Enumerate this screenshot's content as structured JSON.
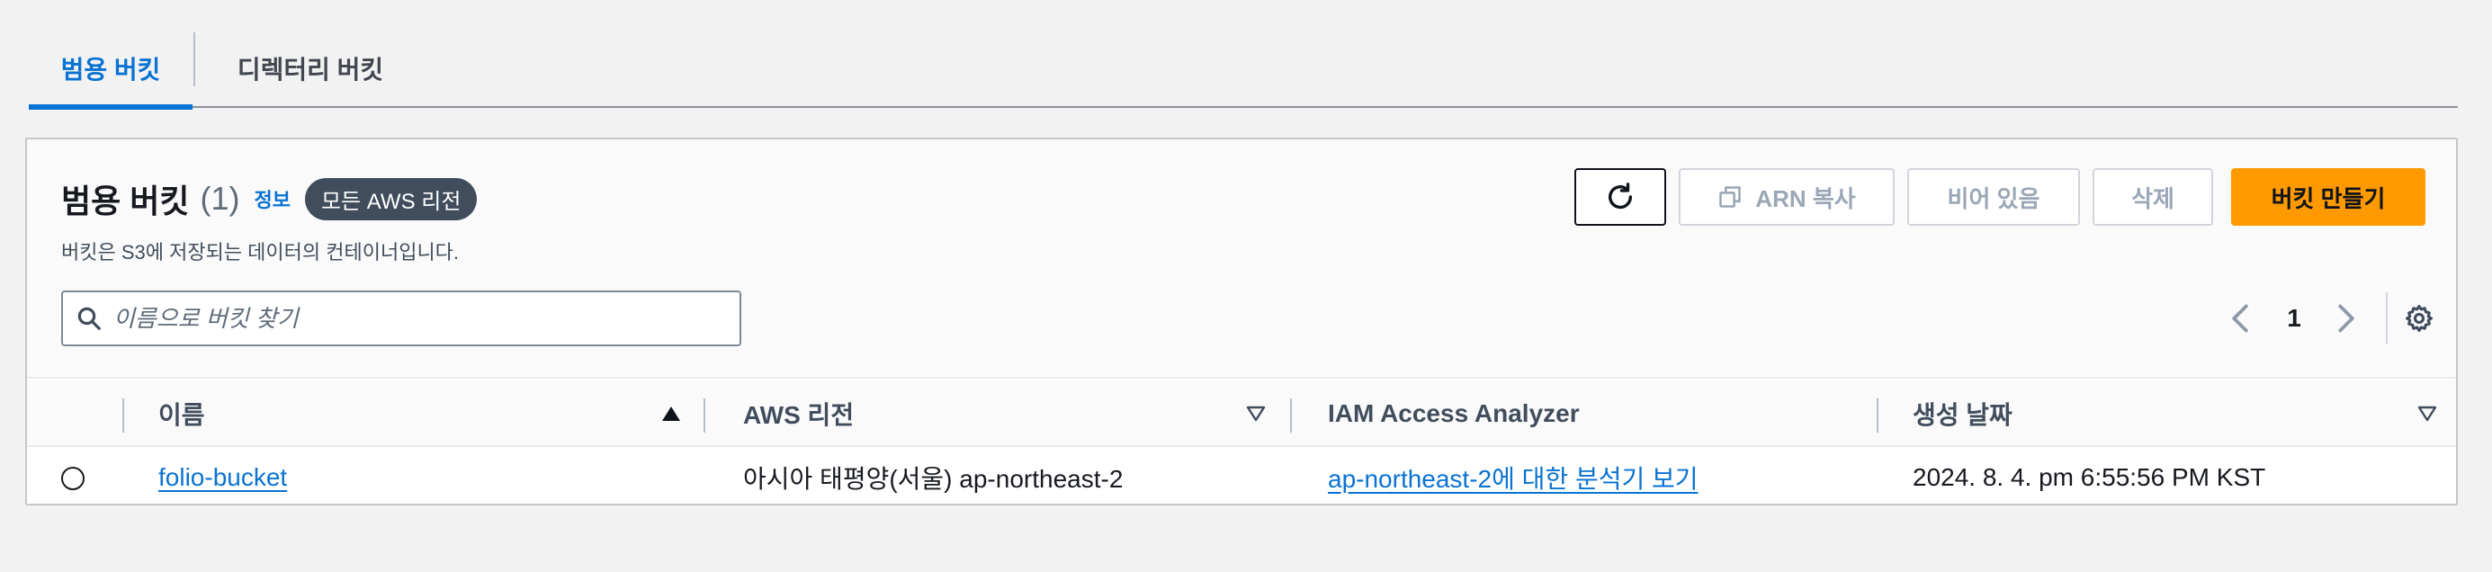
{
  "tabs": {
    "general": "범용 버킷",
    "directory": "디렉터리 버킷"
  },
  "header": {
    "title": "범용 버킷",
    "count": "(1)",
    "info_link": "정보",
    "region_badge": "모든 AWS 리전",
    "description": "버킷은 S3에 저장되는 데이터의 컨테이너입니다."
  },
  "actions": {
    "refresh_icon": "refresh-icon",
    "copy_arn": "ARN 복사",
    "empty": "비어 있음",
    "delete": "삭제",
    "create": "버킷 만들기"
  },
  "search": {
    "placeholder": "이름으로 버킷 찾기",
    "value": ""
  },
  "pagination": {
    "current_page": "1"
  },
  "table": {
    "columns": [
      "이름",
      "AWS 리전",
      "IAM Access Analyzer",
      "생성 날짜"
    ],
    "rows": [
      {
        "name": "folio-bucket",
        "region": "아시아 태평양(서울) ap-northeast-2",
        "analyzer": "ap-northeast-2에 대한 분석기 보기",
        "created": "2024. 8. 4. pm 6:55:56 PM KST"
      }
    ]
  },
  "colors": {
    "accent": "#0972d3",
    "primary_button": "#ff9900",
    "badge": "#414d5c"
  }
}
